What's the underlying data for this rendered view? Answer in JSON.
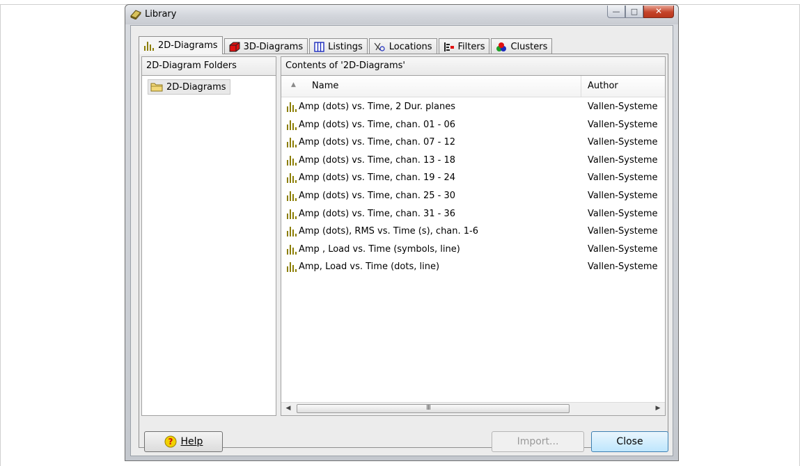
{
  "window": {
    "title": "Library"
  },
  "tabs": [
    {
      "label": "2D-Diagrams",
      "icon": "bar-chart-icon",
      "active": true
    },
    {
      "label": "3D-Diagrams",
      "icon": "cube-icon"
    },
    {
      "label": "Listings",
      "icon": "columns-icon"
    },
    {
      "label": "Locations",
      "icon": "location-icon"
    },
    {
      "label": "Filters",
      "icon": "filter-icon"
    },
    {
      "label": "Clusters",
      "icon": "clusters-icon"
    }
  ],
  "folders": {
    "header": "2D-Diagram Folders",
    "items": [
      {
        "label": "2D-Diagrams",
        "icon": "folder-icon"
      }
    ]
  },
  "contents": {
    "header": "Contents of '2D-Diagrams'",
    "columns": {
      "name": "Name",
      "author": "Author"
    },
    "rows": [
      {
        "name": "Amp (dots) vs. Time, 2 Dur. planes",
        "author": "Vallen-Systeme"
      },
      {
        "name": "Amp (dots) vs. Time, chan. 01 - 06",
        "author": "Vallen-Systeme"
      },
      {
        "name": "Amp (dots) vs. Time, chan. 07 - 12",
        "author": "Vallen-Systeme"
      },
      {
        "name": "Amp (dots) vs. Time, chan. 13 - 18",
        "author": "Vallen-Systeme"
      },
      {
        "name": "Amp (dots) vs. Time, chan. 19 - 24",
        "author": "Vallen-Systeme"
      },
      {
        "name": "Amp (dots) vs. Time, chan. 25 - 30",
        "author": "Vallen-Systeme"
      },
      {
        "name": "Amp (dots) vs. Time, chan. 31 - 36",
        "author": "Vallen-Systeme"
      },
      {
        "name": "Amp (dots), RMS vs. Time (s), chan. 1-6",
        "author": "Vallen-Systeme"
      },
      {
        "name": "Amp , Load vs. Time (symbols, line)",
        "author": "Vallen-Systeme"
      },
      {
        "name": "Amp, Load vs. Time (dots, line)",
        "author": "Vallen-Systeme"
      }
    ]
  },
  "buttons": {
    "help": "Help",
    "import": "Import...",
    "close": "Close"
  },
  "colors": {
    "chart_icon": "#8b7d00",
    "close_button_border": "#3c7fb1",
    "titlebar_close": "#c5442a"
  }
}
